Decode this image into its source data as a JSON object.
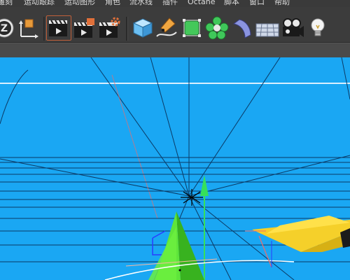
{
  "menubar": {
    "items": [
      "雕刻",
      "运动跟踪",
      "运动图形",
      "角色",
      "流水线",
      "插件",
      "Octane",
      "脚本",
      "窗口",
      "帮助"
    ]
  },
  "toolbar": {
    "buttons": [
      {
        "name": "z-axis-lock-icon"
      },
      {
        "name": "world-coordinate-icon"
      },
      {
        "name": "render-view-icon"
      },
      {
        "name": "render-to-picture-viewer-icon"
      },
      {
        "name": "render-settings-icon"
      },
      {
        "name": "cube-icon"
      },
      {
        "name": "pen-spline-icon"
      },
      {
        "name": "subdivision-surface-icon"
      },
      {
        "name": "cloner-icon"
      },
      {
        "name": "bend-deformer-icon"
      },
      {
        "name": "floor-icon"
      },
      {
        "name": "camera-icon"
      },
      {
        "name": "light-icon"
      }
    ]
  },
  "colors": {
    "viewport_bg": "#1aa7f3",
    "accent": "#e0703a",
    "tree_green": "#5fe53a",
    "plane_yellow": "#f5d02a"
  }
}
